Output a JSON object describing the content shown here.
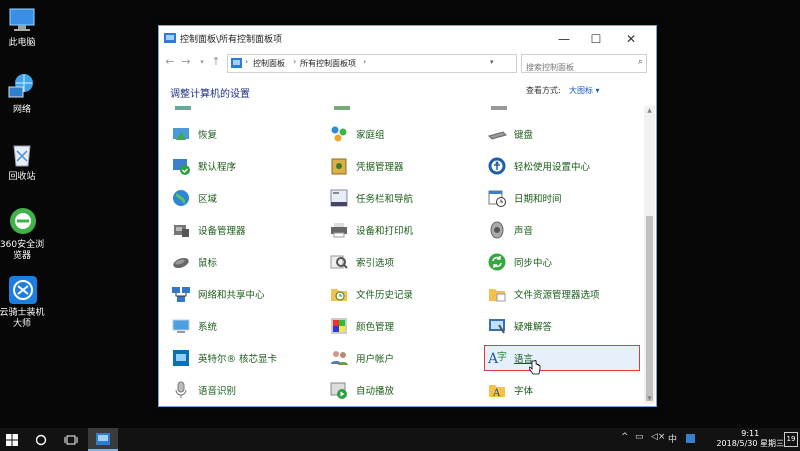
{
  "desktop": {
    "icons": [
      {
        "label": "此电脑"
      },
      {
        "label": "网络"
      },
      {
        "label": "回收站"
      },
      {
        "label": "360安全浏览器"
      },
      {
        "label": "云骑士装机大师"
      }
    ]
  },
  "window": {
    "title": "控制面板\\所有控制面板项",
    "minimize": "—",
    "maximize": "☐",
    "close": "✕",
    "address": {
      "crumbs": [
        "控制面板",
        "所有控制面板项"
      ],
      "separator": "›"
    },
    "search_placeholder": "搜索控制面板",
    "heading": "调整计算机的设置",
    "view_by_label": "查看方式:",
    "view_by_value": "大图标 ▾"
  },
  "items": {
    "col1": [
      "恢复",
      "默认程序",
      "区域",
      "设备管理器",
      "鼠标",
      "网络和共享中心",
      "系统",
      "英特尔® 核芯显卡",
      "语音识别"
    ],
    "col2": [
      "家庭组",
      "凭据管理器",
      "任务栏和导航",
      "设备和打印机",
      "索引选项",
      "文件历史记录",
      "颜色管理",
      "用户帐户",
      "自动播放"
    ],
    "col3": [
      "键盘",
      "轻松使用设置中心",
      "日期和时间",
      "声音",
      "同步中心",
      "文件资源管理器选项",
      "疑难解答",
      "语言",
      "字体"
    ]
  },
  "taskbar": {
    "ime": "中",
    "time": "9:11",
    "date": "2018/5/30 星期三",
    "notif_count": "19"
  },
  "colors": {
    "item_text": "#1a5c1a",
    "heading": "#1e3287",
    "link": "#1a56c2",
    "highlight": "#e6f0fb",
    "selection_outline": "#e23b3b"
  }
}
